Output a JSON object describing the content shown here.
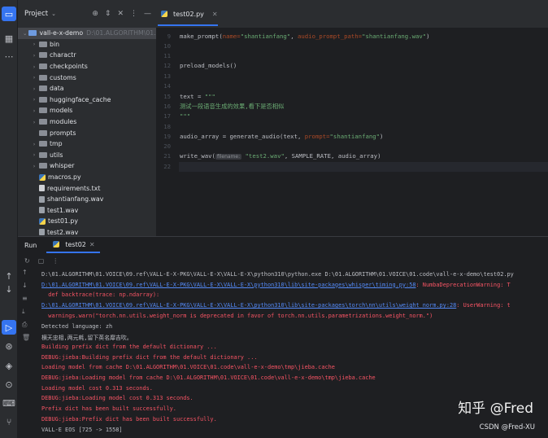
{
  "project": {
    "title": "Project",
    "root_name": "vall-e-x-demo",
    "root_path": "D:\\01.ALGORITHM\\01.V",
    "items": [
      {
        "label": "bin",
        "kind": "folder"
      },
      {
        "label": "charactr",
        "kind": "folder"
      },
      {
        "label": "checkpoints",
        "kind": "folder"
      },
      {
        "label": "customs",
        "kind": "folder"
      },
      {
        "label": "data",
        "kind": "folder"
      },
      {
        "label": "huggingface_cache",
        "kind": "folder"
      },
      {
        "label": "models",
        "kind": "folder"
      },
      {
        "label": "modules",
        "kind": "folder"
      },
      {
        "label": "prompts",
        "kind": "folder"
      },
      {
        "label": "tmp",
        "kind": "folder"
      },
      {
        "label": "utils",
        "kind": "folder"
      },
      {
        "label": "whisper",
        "kind": "folder"
      },
      {
        "label": "macros.py",
        "kind": "py"
      },
      {
        "label": "requirements.txt",
        "kind": "txt"
      },
      {
        "label": "shantianfang.wav",
        "kind": "wav"
      },
      {
        "label": "test1.wav",
        "kind": "wav"
      },
      {
        "label": "test01.py",
        "kind": "py"
      },
      {
        "label": "test2.wav",
        "kind": "wav"
      }
    ]
  },
  "editor": {
    "tab_label": "test02.py",
    "line_numbers": [
      "9",
      "10",
      "11",
      "12",
      "13",
      "14",
      "15",
      "16",
      "17",
      "18",
      "19",
      "20",
      "21",
      "22"
    ],
    "code": {
      "l9_fn": "make_prompt(",
      "l9_name_kw": "name=",
      "l9_name_val": "\"shantianfang\"",
      "l9_sep": ", ",
      "l9_path_kw": "audio_prompt_path=",
      "l9_path_val": "\"shantianfang.wav\"",
      "l9_end": ")",
      "l12": "preload_models()",
      "l15_a": "text = ",
      "l15_b": "\"\"\"",
      "l16": "测试一段语音生成的效果,看下是否相似",
      "l17": "\"\"\"",
      "l19_a": "audio_array = generate_audio(text, ",
      "l19_kw": "prompt=",
      "l19_val": "\"shantianfang\"",
      "l19_end": ")",
      "l21_a": "write_wav(",
      "l21_hint": "filename:",
      "l21_val": "\"test2.wav\"",
      "l21_end": ", SAMPLE_RATE, audio_array)"
    }
  },
  "run": {
    "title": "Run",
    "tab_label": "test02",
    "console": [
      {
        "text": "D:\\01.ALGORITHM\\01.VOICE\\09.ref\\VALL-E-X-PKG\\VALL-E-X\\VALL-E-X\\python310\\python.exe D:\\01.ALGORITHM\\01.VOICE\\01.code\\vall-e-x-demo\\test02.py",
        "style": "white"
      },
      {
        "text": "D:\\01.ALGORITHM\\01.VOICE\\09.ref\\VALL-E-X-PKG\\VALL-E-X\\VALL-E-X\\python310\\lib\\site-packages\\whisper\\timing.py:58",
        "style": "link",
        "suffix": ": NumbaDeprecationWarning: T"
      },
      {
        "text": "  def backtrace(trace: np.ndarray):",
        "style": "red"
      },
      {
        "text": "D:\\01.ALGORITHM\\01.VOICE\\09.ref\\VALL-E-X-PKG\\VALL-E-X\\VALL-E-X\\python310\\lib\\site-packages\\torch\\nn\\utils\\weight_norm.py:28",
        "style": "link",
        "suffix": ": UserWarning: t"
      },
      {
        "text": "  warnings.warn(\"torch.nn.utils.weight_norm is deprecated in favor of torch.nn.utils.parametrizations.weight_norm.\")",
        "style": "red"
      },
      {
        "text": "Detected language: zh",
        "style": "white"
      },
      {
        "text": "横天忠相,两元耗,留下英名靡吉吹。",
        "style": "white"
      },
      {
        "text": "Building prefix dict from the default dictionary ...",
        "style": "red"
      },
      {
        "text": "DEBUG:jieba:Building prefix dict from the default dictionary ...",
        "style": "red"
      },
      {
        "text": "Loading model from cache D:\\01.ALGORITHM\\01.VOICE\\01.code\\vall-e-x-demo\\tmp\\jieba.cache",
        "style": "red"
      },
      {
        "text": "DEBUG:jieba:Loading model from cache D:\\01.ALGORITHM\\01.VOICE\\01.code\\vall-e-x-demo\\tmp\\jieba.cache",
        "style": "red"
      },
      {
        "text": "Loading model cost 0.313 seconds.",
        "style": "red"
      },
      {
        "text": "DEBUG:jieba:Loading model cost 0.313 seconds.",
        "style": "red"
      },
      {
        "text": "Prefix dict has been built successfully.",
        "style": "red"
      },
      {
        "text": "DEBUG:jieba:Prefix dict has been built successfully.",
        "style": "red"
      },
      {
        "text": "VALL-E EOS [725 -> 1558]",
        "style": "white"
      }
    ]
  },
  "watermark": {
    "zhihu": "知乎 @Fred",
    "csdn": "CSDN @Fred-XU"
  },
  "colors": {
    "accent": "#3574f0",
    "error_text": "#f75464",
    "string": "#6aab73",
    "link": "#548af7"
  }
}
